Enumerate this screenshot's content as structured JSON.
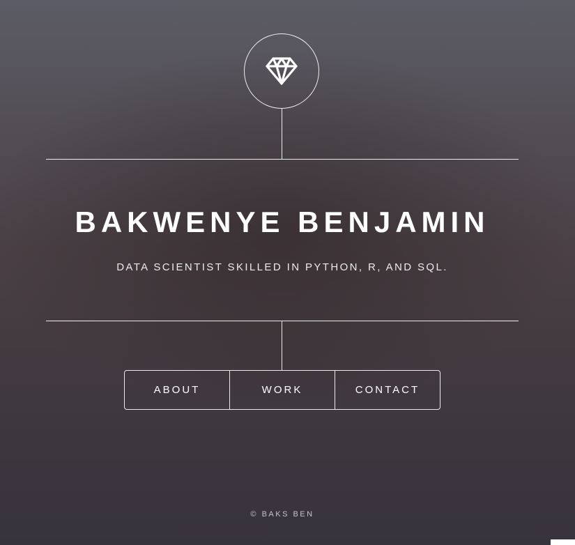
{
  "header": {
    "logo_icon": "diamond-icon",
    "name": "BAKWENYE BENJAMIN",
    "tagline": "DATA SCIENTIST SKILLED IN PYTHON, R, AND SQL."
  },
  "nav": {
    "items": [
      {
        "label": "ABOUT"
      },
      {
        "label": "WORK"
      },
      {
        "label": "CONTACT"
      }
    ]
  },
  "footer": {
    "copyright": "© BAKS BEN"
  },
  "colors": {
    "text": "#ffffff",
    "background_top": "#5c5c66",
    "background_bottom": "#37333d"
  }
}
